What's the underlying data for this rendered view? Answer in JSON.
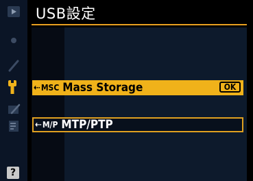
{
  "header": {
    "title": "USB設定"
  },
  "menu": {
    "items": [
      {
        "tag": "MSC",
        "label": "Mass Storage",
        "selected": true,
        "ok_label": "OK"
      },
      {
        "tag": "M/P",
        "label": "MTP/PTP",
        "selected": false
      }
    ]
  },
  "sidebar": {
    "icons": [
      "playback-icon",
      "shooting-icon",
      "custom-settings-icon",
      "setup-wrench-icon",
      "retouch-icon",
      "my-menu-icon"
    ],
    "help_label": "?"
  },
  "colors": {
    "accent": "#f0b21a",
    "rule": "#e8a020",
    "sidebar_bg": "#0b1526",
    "panel_bg": "#0d1a2c"
  }
}
